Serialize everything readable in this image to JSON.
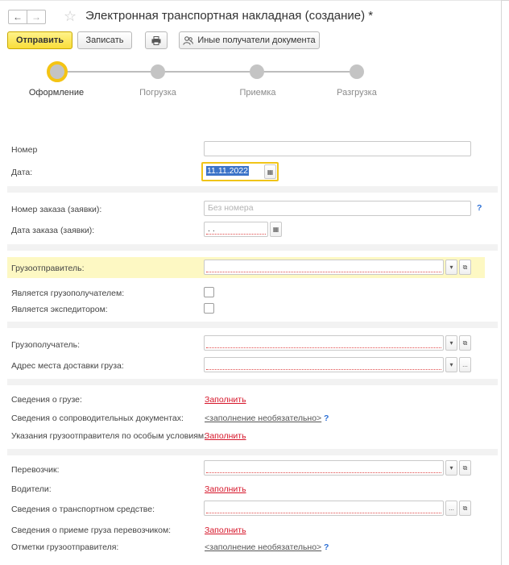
{
  "window": {
    "title": "Электронная транспортная накладная (создание) *",
    "nav_back": "←",
    "nav_forward": "→",
    "star": "☆"
  },
  "toolbar": {
    "send_label": "Отправить",
    "write_label": "Записать",
    "print_icon": "printer-icon",
    "recipients_label": "Иные получатели документа",
    "recipients_icon": "people-icon"
  },
  "steps": [
    {
      "label": "Оформление",
      "active": true
    },
    {
      "label": "Погрузка",
      "active": false
    },
    {
      "label": "Приемка",
      "active": false
    },
    {
      "label": "Разгрузка",
      "active": false
    }
  ],
  "form": {
    "number": {
      "label": "Номер",
      "value": ""
    },
    "date": {
      "label": "Дата:",
      "value": "11.11.2022"
    },
    "order_number": {
      "label": "Номер заказа (заявки):",
      "placeholder": "Без номера"
    },
    "order_date": {
      "label": "Дата заказа (заявки):",
      "value": ". ."
    },
    "shipper": {
      "label": "Грузоотправитель:",
      "value": ""
    },
    "is_consignee": {
      "label": "Является грузополучателем:",
      "checked": false
    },
    "is_forwarder": {
      "label": "Является экспедитором:",
      "checked": false
    },
    "consignee": {
      "label": "Грузополучатель:",
      "value": ""
    },
    "delivery_address": {
      "label": "Адрес места доставки груза:",
      "value": ""
    },
    "cargo_info": {
      "label": "Сведения о грузе:",
      "link": "Заполнить"
    },
    "docs_info": {
      "label": "Сведения о сопроводительных документах:",
      "link": "<заполнение необязательно>"
    },
    "special_conditions": {
      "label": "Указания грузоотправителя по особым условиям:",
      "link": "Заполнить"
    },
    "carrier": {
      "label": "Перевозчик:",
      "value": ""
    },
    "drivers": {
      "label": "Водители:",
      "link": "Заполнить"
    },
    "vehicle": {
      "label": "Сведения о транспортном средстве:",
      "value": ""
    },
    "acceptance": {
      "label": "Сведения о приеме груза перевозчиком:",
      "link": "Заполнить"
    },
    "shipper_marks": {
      "label": "Отметки грузоотправителя:",
      "link": "<заполнение необязательно>"
    }
  },
  "glyphs": {
    "dropdown": "▾",
    "open": "⧉",
    "ellipsis": "...",
    "calendar": "▦",
    "help": "?"
  },
  "colors": {
    "accent_yellow": "#f4c414",
    "link_red": "#d6162a",
    "help_blue": "#2b6fd6",
    "highlight": "#fdf8c3"
  }
}
